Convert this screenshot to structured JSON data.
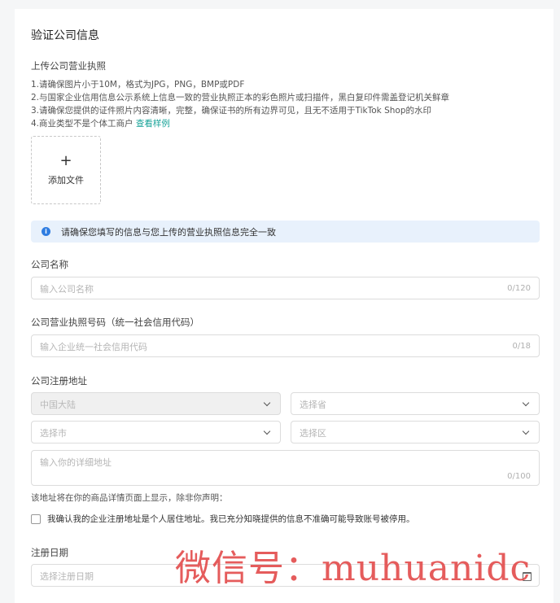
{
  "section": {
    "title": "验证公司信息",
    "upload_label": "上传公司营业执照",
    "requirements": [
      "1.请确保图片小于10M，格式为JPG，PNG，BMP或PDF",
      "2.与国家企业信用信息公示系统上信息一致的营业执照正本的彩色照片或扫描件，黑白复印件需盖登记机关鲜章",
      "3.请确保您提供的证件照片内容清晰，完整，确保证书的所有边界可见，且无不适用于TikTok Shop的水印",
      "4.商业类型不是个体工商户"
    ],
    "view_sample_link": "查看样例",
    "upload_plus": "+",
    "upload_button_text": "添加文件"
  },
  "notice": {
    "icon": "info-icon",
    "text": "请确保您填写的信息与您上传的营业执照信息完全一致"
  },
  "company_name": {
    "label": "公司名称",
    "placeholder": "输入公司名称",
    "counter": "0/120"
  },
  "license_number": {
    "label": "公司营业执照号码（统一社会信用代码）",
    "placeholder": "输入企业统一社会信用代码",
    "counter": "0/18"
  },
  "address": {
    "label": "公司注册地址",
    "country": "中国大陆",
    "province_placeholder": "选择省",
    "city_placeholder": "选择市",
    "district_placeholder": "选择区",
    "detail_placeholder": "输入你的详细地址",
    "detail_counter": "0/100",
    "note": "该地址将在你的商品详情页面上显示，除非你声明：",
    "checkbox_label": "我确认我的企业注册地址是个人居住地址。我已充分知晓提供的信息不准确可能导致账号被停用。"
  },
  "register_date": {
    "label": "注册日期",
    "placeholder": "选择注册日期"
  },
  "watermark": "微信号：muhuanidc",
  "colors": {
    "link": "#17a398",
    "notice_bg": "#e8f1fc",
    "info_icon": "#2f7de1",
    "watermark": "#e34b4b"
  }
}
